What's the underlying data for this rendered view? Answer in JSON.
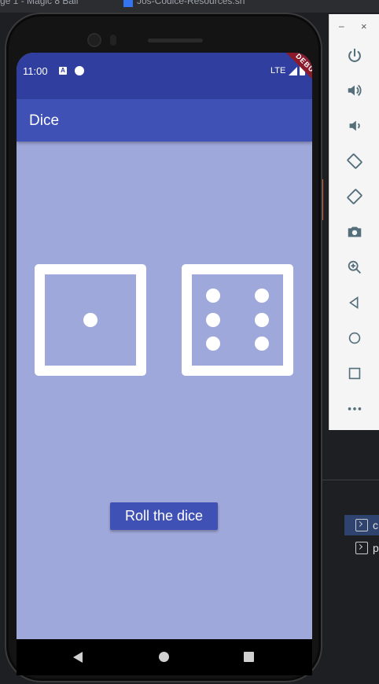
{
  "ide": {
    "top_text_1": "ge 1 - Magic 8 Ball",
    "top_text_2": "Jos-Codice-Resources.sh",
    "terminal_label_1": "c",
    "terminal_label_2": "p"
  },
  "status_bar": {
    "time": "11:00",
    "network": "LTE",
    "debug_banner": "DEBUG"
  },
  "app_bar": {
    "title": "Dice"
  },
  "dice": {
    "left_value": 1,
    "right_value": 6
  },
  "roll_button": {
    "label": "Roll the dice"
  },
  "emulator_toolbar": {
    "minimize": "–",
    "close": "×",
    "buttons": [
      "power-icon",
      "volume-up-icon",
      "volume-down-icon",
      "rotate-left-icon",
      "rotate-right-icon",
      "camera-icon",
      "zoom-icon",
      "back-icon",
      "home-icon",
      "overview-icon",
      "more-icon"
    ]
  },
  "colors": {
    "primary": "#3f51b5",
    "primary_dark": "#303f9f",
    "background": "#9fa8da",
    "debug": "#8b1a2b"
  }
}
